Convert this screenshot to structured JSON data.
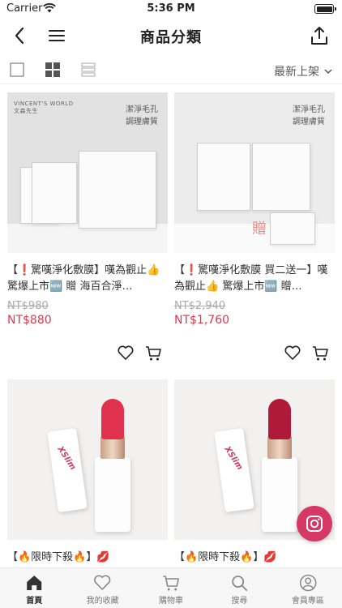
{
  "status": {
    "carrier": "Carrier",
    "time": "5:36 PM"
  },
  "nav": {
    "title": "商品分類"
  },
  "toolbar": {
    "sort_selected": "最新上架"
  },
  "products": [
    {
      "title": "【❗驚嘆淨化敷膜】嘆為觀止👍 驚爆上市🆕 贈 海百合淨…",
      "price_original": "NT$980",
      "price_sale": "NT$880",
      "image_brand": "VINCENT'S WORLD",
      "image_brand_sub": "文森先生",
      "image_tagline_1": "潔淨毛孔",
      "image_tagline_2": "調理膚質"
    },
    {
      "title": "【❗驚嘆淨化敷膜 買二送一】嘆為觀止👍 驚爆上市🆕 贈…",
      "price_original": "NT$2,940",
      "price_sale": "NT$1,760",
      "image_tagline_1": "潔淨毛孔",
      "image_tagline_2": "調理膚質",
      "image_gift": "贈"
    },
    {
      "title": "【🔥限時下殺🔥】💋"
    },
    {
      "title": "【🔥限時下殺🔥】💋"
    }
  ],
  "tabs": [
    {
      "label": "首頁",
      "icon": "home-icon",
      "active": true
    },
    {
      "label": "我的收藏",
      "icon": "heart-icon",
      "active": false
    },
    {
      "label": "購物車",
      "icon": "cart-icon",
      "active": false
    },
    {
      "label": "搜尋",
      "icon": "search-icon",
      "active": false
    },
    {
      "label": "會員專區",
      "icon": "user-icon",
      "active": false
    }
  ],
  "colors": {
    "price_sale": "#e0364f",
    "lipstick_1": "#e0324f",
    "lipstick_2": "#b01a3a",
    "instagram": "#d63865"
  }
}
